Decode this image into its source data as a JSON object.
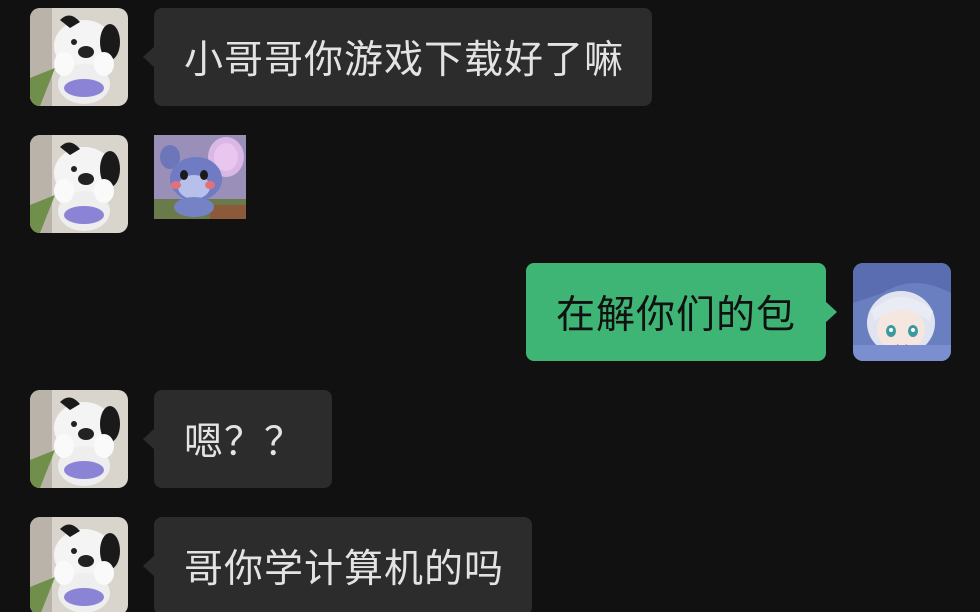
{
  "colors": {
    "background": "#111111",
    "bubble_in": "#2c2c2c",
    "bubble_out": "#3eb575",
    "text_in": "#e3e3e3",
    "text_out": "#111111"
  },
  "messages": [
    {
      "sender": "contact",
      "type": "text",
      "text": "小哥哥你游戏下载好了嘛",
      "avatar": "white-puppy-plush-avatar"
    },
    {
      "sender": "contact",
      "type": "sticker",
      "sticker": "cartoon-mouse-sticker",
      "avatar": "white-puppy-plush-avatar"
    },
    {
      "sender": "me",
      "type": "text",
      "text": "在解你们的包",
      "avatar": "anime-girl-avatar"
    },
    {
      "sender": "contact",
      "type": "text",
      "text": "嗯？？",
      "avatar": "white-puppy-plush-avatar"
    },
    {
      "sender": "contact",
      "type": "text",
      "text": "哥你学计算机的吗",
      "avatar": "white-puppy-plush-avatar"
    }
  ]
}
